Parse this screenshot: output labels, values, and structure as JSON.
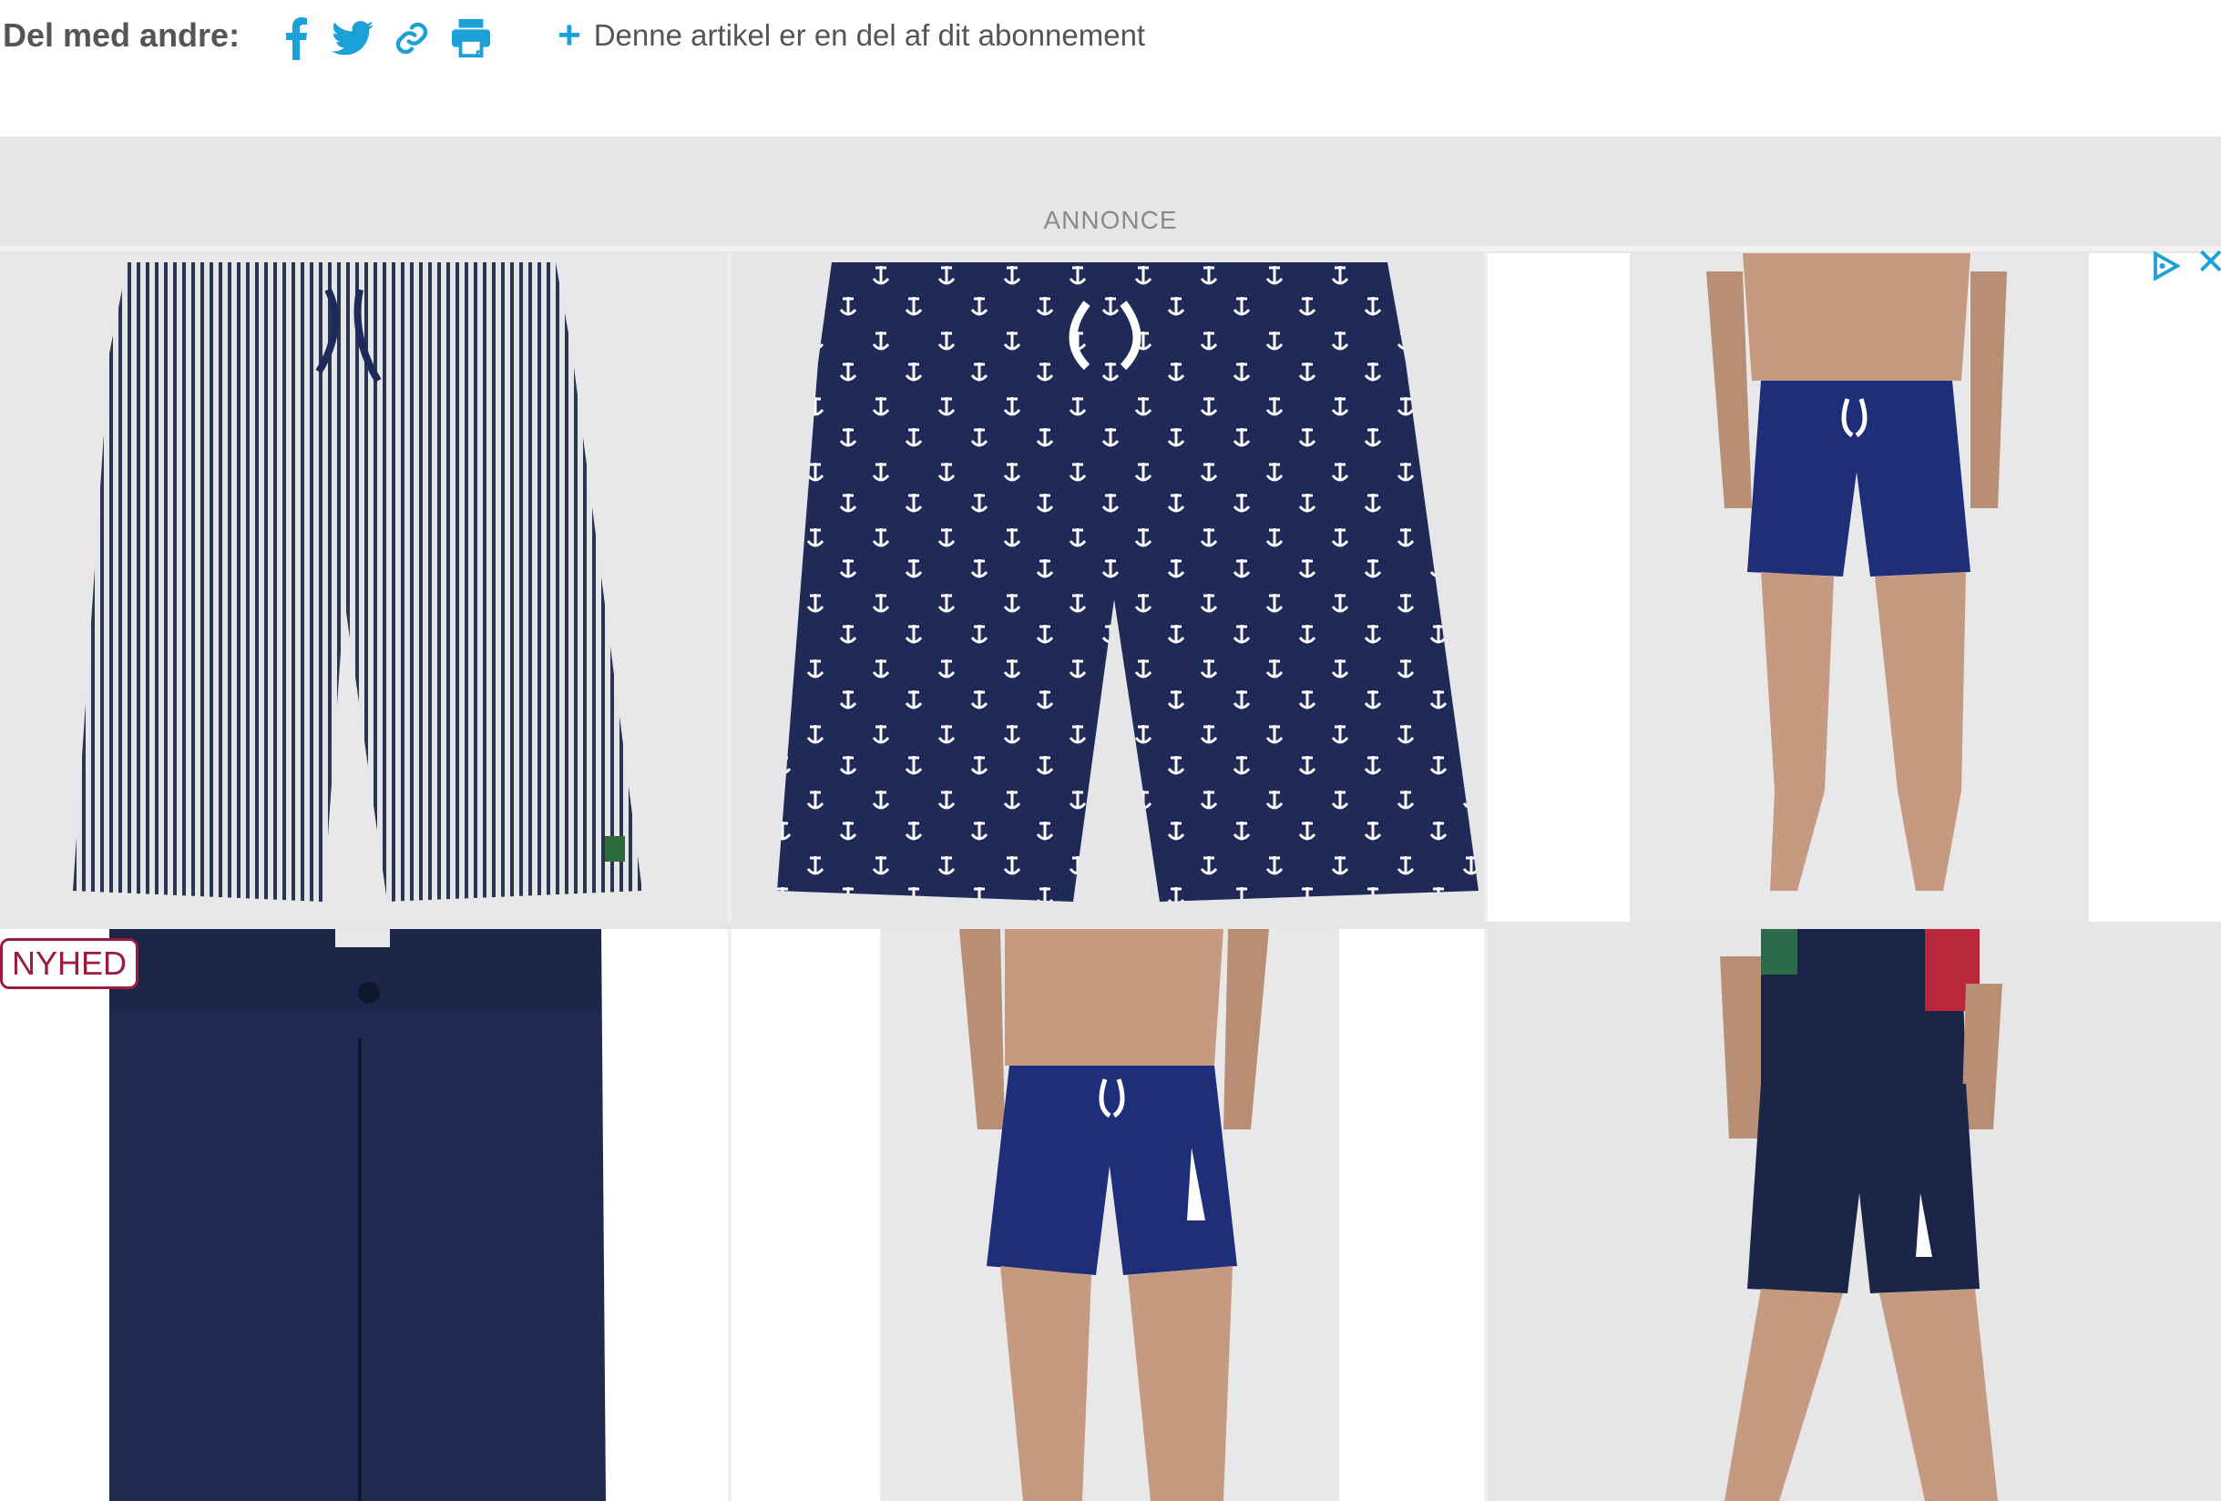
{
  "share": {
    "label": "Del med andre:",
    "icons": [
      "facebook-icon",
      "twitter-icon",
      "link-icon",
      "print-icon"
    ],
    "subscription_note": "Denne artikel er en del af dit abonnement"
  },
  "ad": {
    "label": "ANNONCE",
    "products": [
      {
        "name": "striped-shorts"
      },
      {
        "name": "anchor-print-swim-shorts"
      },
      {
        "name": "navy-swim-shorts-model"
      },
      {
        "name": "navy-chino-shorts",
        "badge": "NYHED"
      },
      {
        "name": "navy-swim-shorts-sailboat-model"
      },
      {
        "name": "navy-sweat-shorts-model"
      }
    ]
  },
  "colors": {
    "accent": "#1ba0d8",
    "badge": "#9b1c3c",
    "navy": "#1d2a5a"
  }
}
